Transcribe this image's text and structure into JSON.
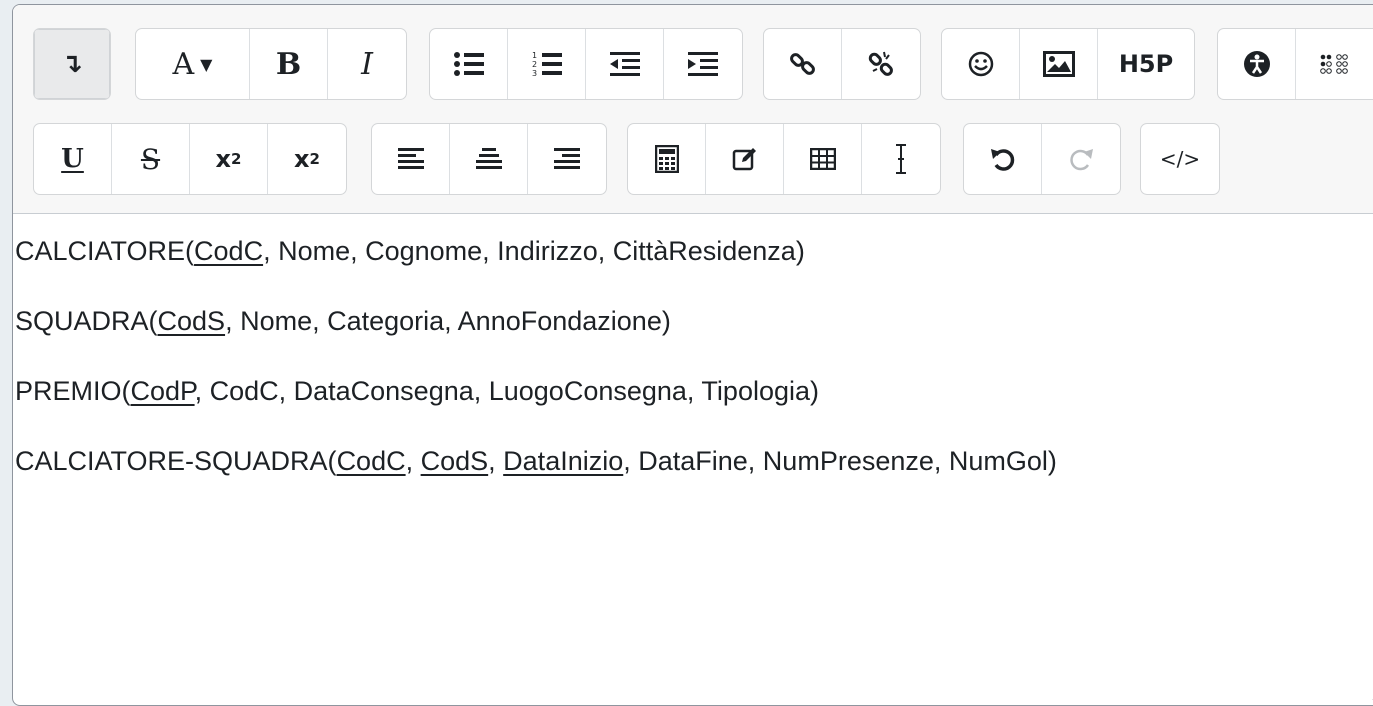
{
  "toolbar": {
    "row1": {
      "toggle_label": "↴",
      "font_color_label": "A",
      "bold_label": "B",
      "italic_label": "I",
      "h5p_label": "H5P"
    },
    "row2": {
      "underline_label": "U",
      "strike_label": "S",
      "subscript_label": "x",
      "subscript_sub": "2",
      "superscript_label": "x",
      "superscript_sup": "2",
      "html_label": "</>"
    }
  },
  "content": {
    "lines": [
      {
        "pre": "CALCIATORE(",
        "keys": [
          "CodC"
        ],
        "post": ", Nome, Cognome, Indirizzo, CittàResidenza)"
      },
      {
        "pre": "SQUADRA(",
        "keys": [
          "CodS"
        ],
        "post": ", Nome, Categoria, AnnoFondazione)"
      },
      {
        "pre": "PREMIO(",
        "keys": [
          "CodP"
        ],
        "post": ", CodC, DataConsegna, LuogoConsegna, Tipologia)"
      },
      {
        "pre": "CALCIATORE-SQUADRA(",
        "keys": [
          "CodC",
          "CodS",
          "DataInizio"
        ],
        "post": ", DataFine, NumPresenze, NumGol)"
      }
    ],
    "key_separator": ", "
  },
  "colors": {
    "text": "#1d2125",
    "border": "#8f959e",
    "toolbar_bg": "#f7f7f7",
    "disabled": "#b9bcbf"
  }
}
